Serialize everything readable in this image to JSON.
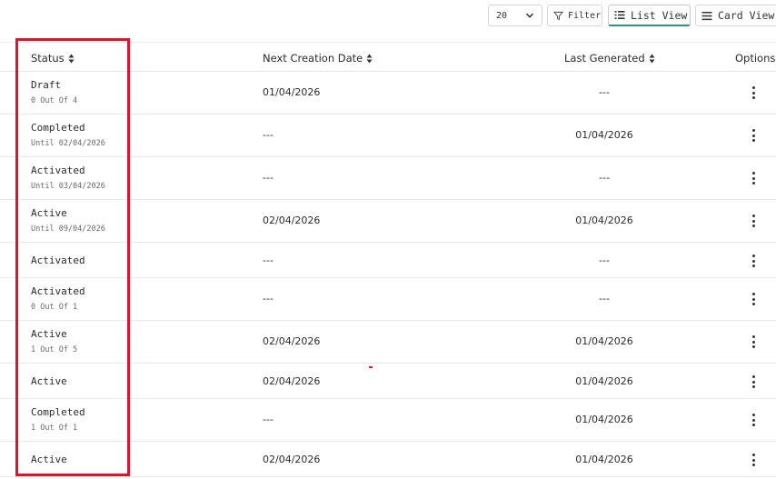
{
  "toolbar": {
    "page_size": "20",
    "filter_label": "Filter",
    "list_view_label": "List View",
    "card_view_label": "Card View"
  },
  "columns": {
    "status": "Status",
    "next_creation_date": "Next Creation Date",
    "last_generated": "Last Generated",
    "options": "Options"
  },
  "rows": [
    {
      "status": "Draft",
      "sub": "0 Out Of 4",
      "next": "01/04/2026",
      "last": "---"
    },
    {
      "status": "Completed",
      "sub": "Until 02/04/2026",
      "next": "---",
      "last": "01/04/2026"
    },
    {
      "status": "Activated",
      "sub": "Until 03/04/2026",
      "next": "---",
      "last": "---"
    },
    {
      "status": "Active",
      "sub": "Until 09/04/2026",
      "next": "02/04/2026",
      "last": "01/04/2026"
    },
    {
      "status": "Activated",
      "sub": "",
      "next": "---",
      "last": "---"
    },
    {
      "status": "Activated",
      "sub": "0 Out Of 1",
      "next": "---",
      "last": "---"
    },
    {
      "status": "Active",
      "sub": "1 Out Of 5",
      "next": "02/04/2026",
      "last": "01/04/2026"
    },
    {
      "status": "Active",
      "sub": "",
      "next": "02/04/2026",
      "last": "01/04/2026"
    },
    {
      "status": "Completed",
      "sub": "1 Out Of 1",
      "next": "---",
      "last": "01/04/2026"
    },
    {
      "status": "Active",
      "sub": "",
      "next": "02/04/2026",
      "last": "01/04/2026"
    }
  ],
  "colors": {
    "highlight": "#e0142a",
    "active_view_underline": "#2f8f8f"
  }
}
